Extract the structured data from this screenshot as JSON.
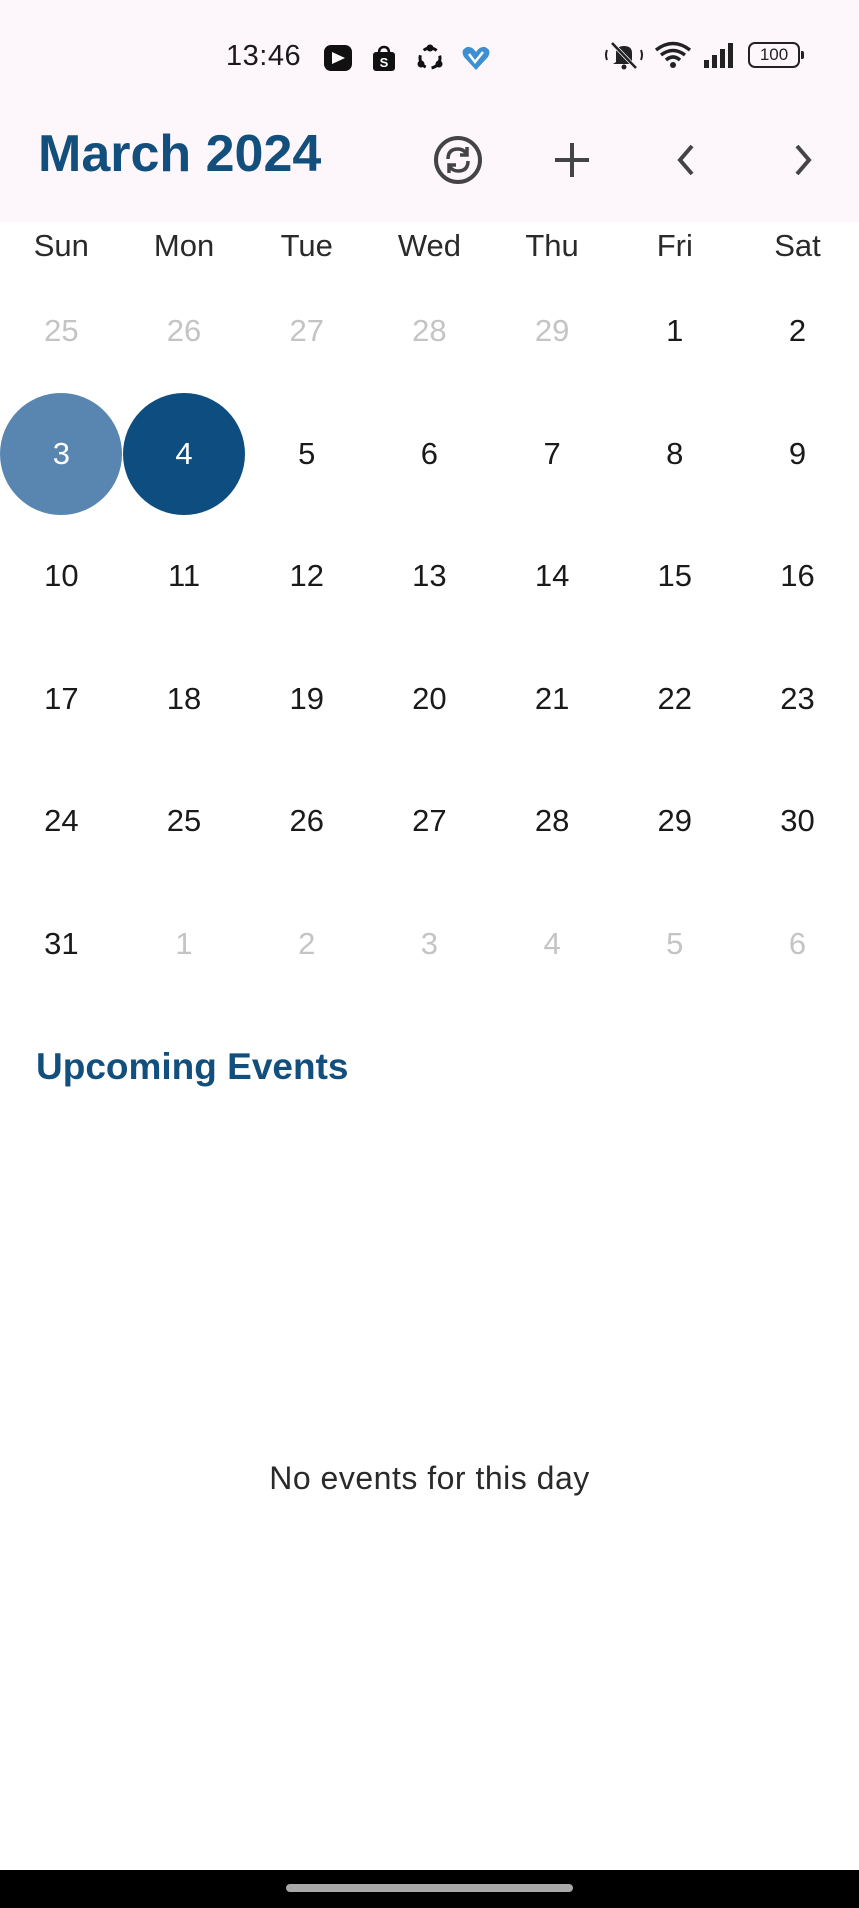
{
  "status_bar": {
    "time": "13:46",
    "notification_icons": [
      "video-app-icon",
      "shopee-bag-icon",
      "sync-app-icon",
      "heart-app-icon"
    ],
    "system_icons": [
      "mute-bell-icon",
      "wifi-icon",
      "signal-icon",
      "battery-icon"
    ],
    "battery_level": "100"
  },
  "header": {
    "title": "March 2024",
    "actions": [
      "sync-icon",
      "add-icon",
      "previous-month-icon",
      "next-month-icon"
    ],
    "accent_color": "#134f7d"
  },
  "calendar": {
    "weekdays": [
      "Sun",
      "Mon",
      "Tue",
      "Wed",
      "Thu",
      "Fri",
      "Sat"
    ],
    "weeks": [
      [
        {
          "d": "25",
          "o": true
        },
        {
          "d": "26",
          "o": true
        },
        {
          "d": "27",
          "o": true
        },
        {
          "d": "28",
          "o": true
        },
        {
          "d": "29",
          "o": true
        },
        {
          "d": "1"
        },
        {
          "d": "2"
        }
      ],
      [
        {
          "d": "3",
          "s": "today"
        },
        {
          "d": "4",
          "s": "selected"
        },
        {
          "d": "5"
        },
        {
          "d": "6"
        },
        {
          "d": "7"
        },
        {
          "d": "8"
        },
        {
          "d": "9"
        }
      ],
      [
        {
          "d": "10"
        },
        {
          "d": "11"
        },
        {
          "d": "12"
        },
        {
          "d": "13"
        },
        {
          "d": "14"
        },
        {
          "d": "15"
        },
        {
          "d": "16"
        }
      ],
      [
        {
          "d": "17"
        },
        {
          "d": "18"
        },
        {
          "d": "19"
        },
        {
          "d": "20"
        },
        {
          "d": "21"
        },
        {
          "d": "22"
        },
        {
          "d": "23"
        }
      ],
      [
        {
          "d": "24"
        },
        {
          "d": "25"
        },
        {
          "d": "26"
        },
        {
          "d": "27"
        },
        {
          "d": "28"
        },
        {
          "d": "29"
        },
        {
          "d": "30"
        }
      ],
      [
        {
          "d": "31"
        },
        {
          "d": "1",
          "o": true
        },
        {
          "d": "2",
          "o": true
        },
        {
          "d": "3",
          "o": true
        },
        {
          "d": "4",
          "o": true
        },
        {
          "d": "5",
          "o": true
        },
        {
          "d": "6",
          "o": true
        }
      ]
    ],
    "today_color": "#5886b0",
    "selected_color": "#0e4d80"
  },
  "events": {
    "title": "Upcoming Events",
    "empty_message": "No events for this day"
  }
}
